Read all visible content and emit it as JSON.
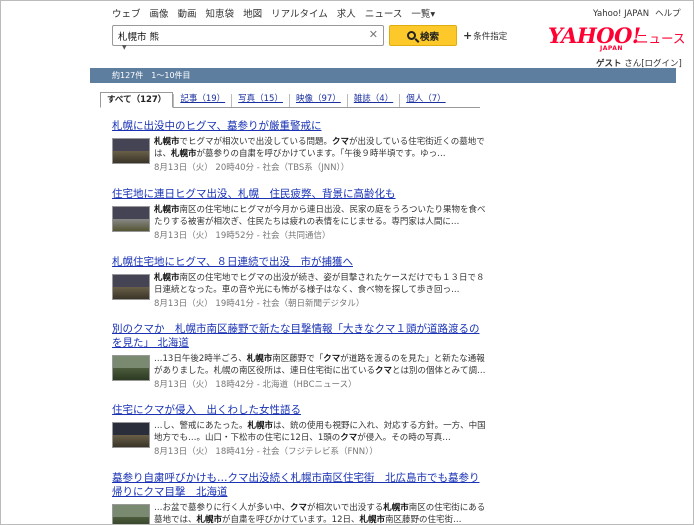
{
  "nav": {
    "items": [
      "ウェブ",
      "画像",
      "動画",
      "知恵袋",
      "地図",
      "リアルタイム",
      "求人",
      "ニュース",
      "一覧"
    ],
    "more_arrow": "▾",
    "links": [
      "Yahoo! JAPAN",
      "ヘルプ"
    ]
  },
  "search": {
    "query": "札幌市 熊",
    "clear": "✕",
    "button": "検索",
    "conditions": "条件指定",
    "conditions_prefix": "+",
    "toggle": "▼"
  },
  "logo": {
    "brand": "YAHOO!",
    "sub": "JAPAN",
    "service": "ニュース"
  },
  "user": {
    "name": "ゲスト",
    "suffix": "さん",
    "login": "[ログイン]"
  },
  "summary": "約127件　1〜10件目",
  "tabs": [
    {
      "label": "すべて（127）"
    },
    {
      "label": "記事（19）"
    },
    {
      "label": "写真（15）"
    },
    {
      "label": "映像（97）"
    },
    {
      "label": "雑誌（4）"
    },
    {
      "label": "個人（7）"
    }
  ],
  "results": [
    {
      "title": "札幌に出没中のヒグマ、墓参りが厳重警戒に",
      "snippet": "札幌市でヒグマが相次いで出没している問題。クマが出没している住宅街近くの墓地では、札幌市が墓参りの自粛を呼びかけています。「午後９時半頃です。ゆっ…",
      "meta": "8月13日（火） 20時40分 - 社会（TBS系（JNN））"
    },
    {
      "title": "住宅地に連日ヒグマ出没、札幌　住民疲弊、背景に高齢化も",
      "snippet": "札幌市南区の住宅地にヒグマが今月から連日出没、民家の庭をうろついたり果物を食べたりする被害が相次ぎ、住民たちは疲れの表情をにじませる。専門家は人間に…",
      "meta": "8月13日（火） 19時52分 - 社会（共同通信）"
    },
    {
      "title": "札幌住宅地にヒグマ、８日連続で出没　市が捕獲へ",
      "snippet": "札幌市南区の住宅地でヒグマの出没が続き、姿が目撃されたケースだけでも１３日で８日連続となった。車の音や光にも怖がる様子はなく、食べ物を探して歩き回っ…",
      "meta": "8月13日（火） 19時41分 - 社会（朝日新聞デジタル）"
    },
    {
      "title": "別のクマか　札幌市南区藤野で新たな目撃情報「大きなクマ１頭が道路渡るのを見た」 北海道",
      "snippet": "…13日午後2時半ごろ、札幌市南区藤野で「クマが道路を渡るのを見た」と新たな通報がありました。札幌の南区役所は、連日住宅街に出ているクマとは別の個体とみて調…",
      "meta": "8月13日（火） 18時42分 - 北海道（HBCニュース）"
    },
    {
      "title": "住宅にクマが侵入　出くわした女性語る",
      "snippet": "…し、警戒にあたった。札幌市は、銃の使用も視野に入れ、対応する方針。一方、中国地方でも…。山口・下松市の住宅に12日、1頭のクマが侵入。その時の写真…",
      "meta": "8月13日（火） 18時41分 - 社会（フジテレビ系（FNN））"
    },
    {
      "title": "墓参り自粛呼びかけも…クマ出没続く札幌市南区住宅街　北広島市でも墓参り帰りにクマ目撃　北海道",
      "snippet": "…お盆で墓参りに行く人が多い中、クマが相次いで出没する札幌市南区の住宅街にある墓地では、札幌市が自粛を呼びかけています。12日、札幌市南区藤野の住宅街…",
      "meta": ""
    }
  ]
}
